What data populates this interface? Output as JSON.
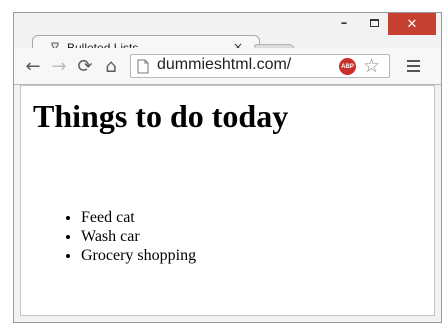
{
  "window": {
    "minimize_glyph": "–",
    "close_glyph": "✕"
  },
  "tab": {
    "title": "Bulleted Lists",
    "close_glyph": "×"
  },
  "toolbar": {
    "back_glyph": "←",
    "forward_glyph": "→",
    "reload_glyph": "⟳",
    "home_glyph": "⌂",
    "url": "dummieshtml.com/",
    "adblock_label": "ABP",
    "star_glyph": "☆"
  },
  "page": {
    "heading": "Things to do today",
    "items": [
      "Feed cat",
      "Wash car",
      "Grocery shopping"
    ]
  },
  "colors": {
    "close_button": "#c74133",
    "adblock": "#c8302c"
  },
  "icons": {
    "tab": "page-favicon-icon",
    "back": "back-arrow-icon",
    "forward": "forward-arrow-icon",
    "reload": "reload-icon",
    "home": "home-icon",
    "page": "page-icon",
    "adblock": "adblock-icon",
    "bookmark": "star-icon",
    "menu": "hamburger-menu-icon"
  }
}
